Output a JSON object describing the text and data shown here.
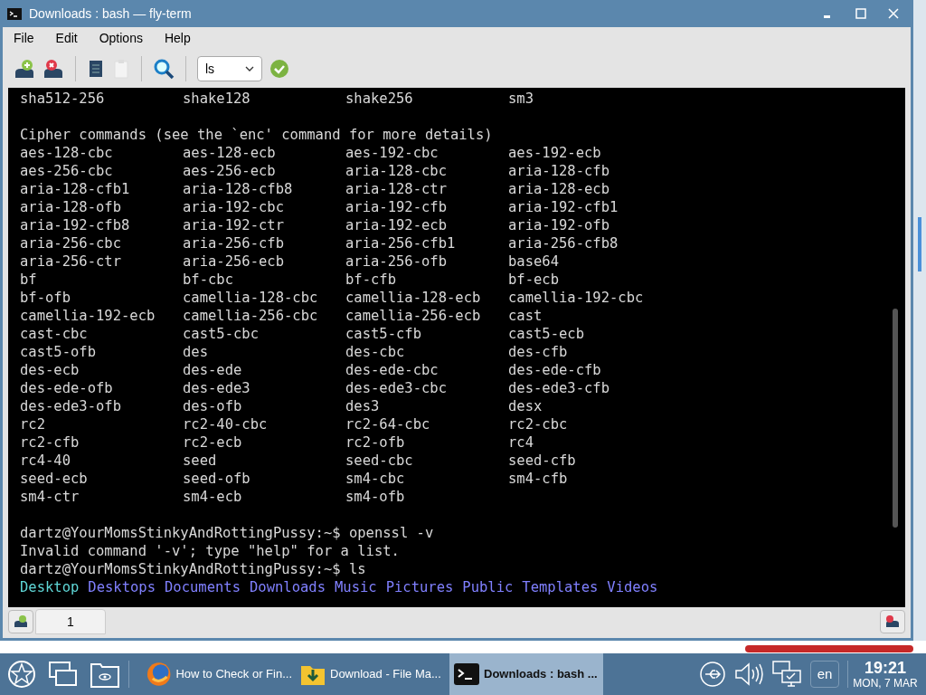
{
  "window": {
    "title": "Downloads : bash — fly-term"
  },
  "menu": [
    "File",
    "Edit",
    "Options",
    "Help"
  ],
  "toolbar": {
    "command": "ls"
  },
  "terminal": {
    "lines": [
      {
        "kind": "row",
        "cells": [
          "sha512-256",
          "shake128",
          "shake256",
          "sm3"
        ]
      },
      {
        "kind": "blank"
      },
      {
        "kind": "text",
        "text": "Cipher commands (see the `enc' command for more details)"
      },
      {
        "kind": "row",
        "cells": [
          "aes-128-cbc",
          "aes-128-ecb",
          "aes-192-cbc",
          "aes-192-ecb"
        ]
      },
      {
        "kind": "row",
        "cells": [
          "aes-256-cbc",
          "aes-256-ecb",
          "aria-128-cbc",
          "aria-128-cfb"
        ]
      },
      {
        "kind": "row",
        "cells": [
          "aria-128-cfb1",
          "aria-128-cfb8",
          "aria-128-ctr",
          "aria-128-ecb"
        ]
      },
      {
        "kind": "row",
        "cells": [
          "aria-128-ofb",
          "aria-192-cbc",
          "aria-192-cfb",
          "aria-192-cfb1"
        ]
      },
      {
        "kind": "row",
        "cells": [
          "aria-192-cfb8",
          "aria-192-ctr",
          "aria-192-ecb",
          "aria-192-ofb"
        ]
      },
      {
        "kind": "row",
        "cells": [
          "aria-256-cbc",
          "aria-256-cfb",
          "aria-256-cfb1",
          "aria-256-cfb8"
        ]
      },
      {
        "kind": "row",
        "cells": [
          "aria-256-ctr",
          "aria-256-ecb",
          "aria-256-ofb",
          "base64"
        ]
      },
      {
        "kind": "row",
        "cells": [
          "bf",
          "bf-cbc",
          "bf-cfb",
          "bf-ecb"
        ]
      },
      {
        "kind": "row",
        "cells": [
          "bf-ofb",
          "camellia-128-cbc",
          "camellia-128-ecb",
          "camellia-192-cbc"
        ]
      },
      {
        "kind": "row",
        "cells": [
          "camellia-192-ecb",
          "camellia-256-cbc",
          "camellia-256-ecb",
          "cast"
        ]
      },
      {
        "kind": "row",
        "cells": [
          "cast-cbc",
          "cast5-cbc",
          "cast5-cfb",
          "cast5-ecb"
        ]
      },
      {
        "kind": "row",
        "cells": [
          "cast5-ofb",
          "des",
          "des-cbc",
          "des-cfb"
        ]
      },
      {
        "kind": "row",
        "cells": [
          "des-ecb",
          "des-ede",
          "des-ede-cbc",
          "des-ede-cfb"
        ]
      },
      {
        "kind": "row",
        "cells": [
          "des-ede-ofb",
          "des-ede3",
          "des-ede3-cbc",
          "des-ede3-cfb"
        ]
      },
      {
        "kind": "row",
        "cells": [
          "des-ede3-ofb",
          "des-ofb",
          "des3",
          "desx"
        ]
      },
      {
        "kind": "row",
        "cells": [
          "rc2",
          "rc2-40-cbc",
          "rc2-64-cbc",
          "rc2-cbc"
        ]
      },
      {
        "kind": "row",
        "cells": [
          "rc2-cfb",
          "rc2-ecb",
          "rc2-ofb",
          "rc4"
        ]
      },
      {
        "kind": "row",
        "cells": [
          "rc4-40",
          "seed",
          "seed-cbc",
          "seed-cfb"
        ]
      },
      {
        "kind": "row",
        "cells": [
          "seed-ecb",
          "seed-ofb",
          "sm4-cbc",
          "sm4-cfb"
        ]
      },
      {
        "kind": "row",
        "cells": [
          "sm4-ctr",
          "sm4-ecb",
          "sm4-ofb"
        ]
      },
      {
        "kind": "blank"
      },
      {
        "kind": "text",
        "text": "dartz@YourMomsStinkyAndRottingPussy:~$ openssl -v"
      },
      {
        "kind": "text",
        "text": "Invalid command '-v'; type \"help\" for a list."
      },
      {
        "kind": "text",
        "text": "dartz@YourMomsStinkyAndRottingPussy:~$ ls"
      },
      {
        "kind": "listing",
        "items": [
          {
            "text": "Desktop",
            "color": "#5fd7d7"
          },
          {
            "text": "Desktops",
            "color": "#8080ff"
          },
          {
            "text": "Documents",
            "color": "#8080ff"
          },
          {
            "text": "Downloads",
            "color": "#8080ff"
          },
          {
            "text": "Music",
            "color": "#8080ff"
          },
          {
            "text": "Pictures",
            "color": "#8080ff"
          },
          {
            "text": "Public",
            "color": "#8080ff"
          },
          {
            "text": "Templates",
            "color": "#8080ff"
          },
          {
            "text": "Videos",
            "color": "#8080ff"
          }
        ]
      }
    ]
  },
  "tabs": [
    {
      "label": "1",
      "selected": true
    }
  ],
  "taskbar": {
    "tasks": [
      {
        "kind": "browser",
        "label": "How to Check or Fin...",
        "selected": false
      },
      {
        "kind": "files",
        "label": "Download - File Ma...",
        "selected": false
      },
      {
        "kind": "terminal",
        "label": "Downloads : bash ...",
        "selected": true
      }
    ],
    "language": "en",
    "time": "19:21",
    "date": "MON, 7 MAR"
  }
}
